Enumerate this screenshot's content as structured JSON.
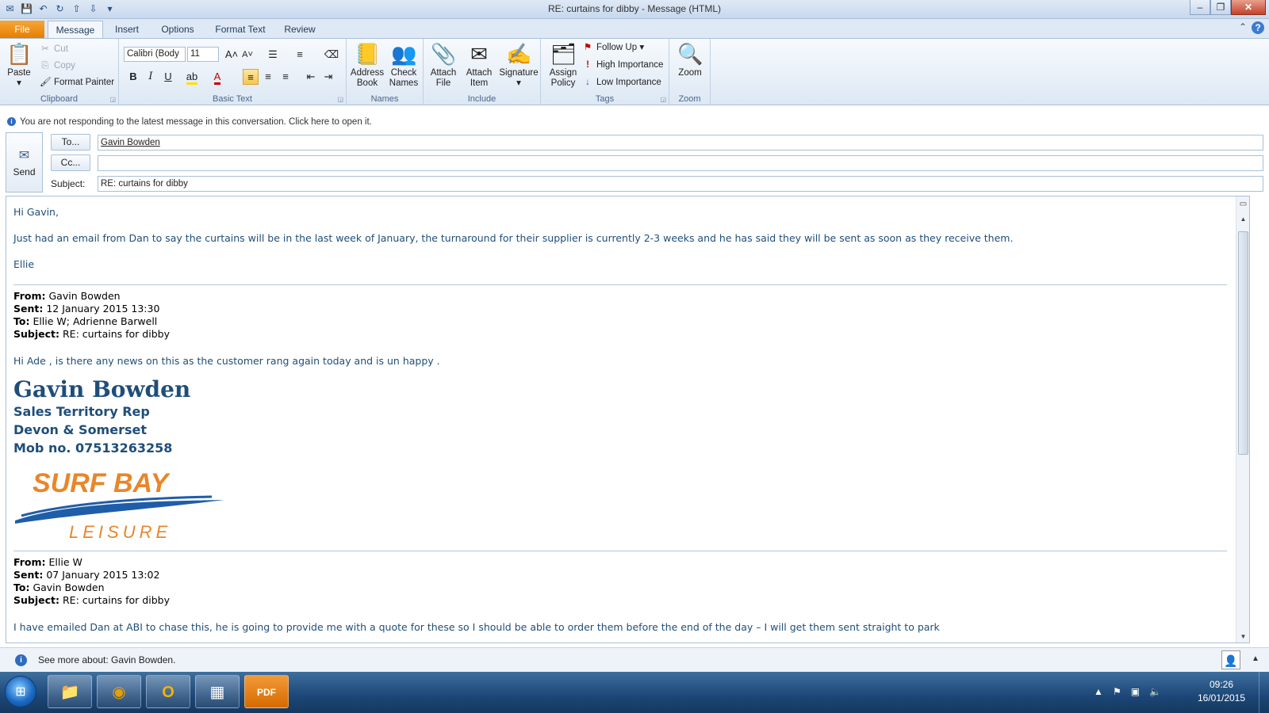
{
  "window": {
    "title": "RE: curtains for dibby  -  Message (HTML)",
    "controls": {
      "minimize": "–",
      "maximize": "❐",
      "close": "✕"
    }
  },
  "quick_access": [
    {
      "name": "outlook-app-icon",
      "glyph": "✉"
    },
    {
      "name": "save-icon",
      "glyph": "💾"
    },
    {
      "name": "undo-icon",
      "glyph": "↶"
    },
    {
      "name": "redo-icon",
      "glyph": "↻"
    },
    {
      "name": "up-icon",
      "glyph": "⇧"
    },
    {
      "name": "down-icon",
      "glyph": "⇩"
    },
    {
      "name": "customize-icon",
      "glyph": "▾"
    }
  ],
  "ribbon_tabs": [
    "File",
    "Message",
    "Insert",
    "Options",
    "Format Text",
    "Review"
  ],
  "ribbon": {
    "clipboard": {
      "label": "Clipboard",
      "paste": "Paste",
      "cut": "Cut",
      "copy": "Copy",
      "format_painter": "Format Painter"
    },
    "basic_text": {
      "label": "Basic Text",
      "font": "Calibri (Body",
      "size": "11",
      "bold": "B",
      "italic": "I",
      "underline": "U"
    },
    "names": {
      "label": "Names",
      "address_book": "Address Book",
      "check_names": "Check Names"
    },
    "include": {
      "label": "Include",
      "attach_file": "Attach File",
      "attach_item": "Attach Item",
      "signature": "Signature"
    },
    "tags": {
      "label": "Tags",
      "assign_policy": "Assign Policy",
      "follow_up": "Follow Up",
      "high_importance": "High Importance",
      "low_importance": "Low Importance"
    },
    "zoom": {
      "label": "Zoom",
      "zoom": "Zoom"
    }
  },
  "info_bar": "You are not responding to the latest message in this conversation. Click here to open it.",
  "compose": {
    "send": "Send",
    "to_button": "To...",
    "cc_button": "Cc...",
    "subject_label": "Subject:",
    "to_value": "Gavin Bowden",
    "cc_value": "",
    "subject_value": "RE: curtains for dibby"
  },
  "message": {
    "greeting": "Hi Gavin,",
    "paragraph": "Just had an email from Dan to say the curtains will be in the last week of January, the turnaround for their supplier is currently 2-3 weeks and he has said they will be sent as soon as they receive them.",
    "sign_off": "Ellie",
    "quoted1": {
      "from_label": "From:",
      "from": "Gavin Bowden",
      "sent_label": "Sent:",
      "sent": "12 January 2015 13:30",
      "to_label": "To:",
      "to": "Ellie W; Adrienne Barwell",
      "subject_label": "Subject:",
      "subject": "RE: curtains for dibby",
      "body": "Hi Ade , is there any news on this as the customer rang again today and is un happy ."
    },
    "signature": {
      "name": "Gavin Bowden",
      "title": "Sales Territory Rep",
      "region": "Devon & Somerset",
      "mobile": "Mob no. 07513263258",
      "logo_top": "SURF BAY",
      "logo_bottom": "LEISURE",
      "logo_color": "#e8862a",
      "wave_color": "#1f5da8"
    },
    "quoted2": {
      "from_label": "From:",
      "from": "Ellie W",
      "sent_label": "Sent:",
      "sent": "07 January 2015 13:02",
      "to_label": "To:",
      "to": "Gavin Bowden",
      "subject_label": "Subject:",
      "subject": "RE: curtains for dibby",
      "body_partial": "I have emailed Dan at ABI to chase this, he is going to provide me with a quote for these so I should be able to order them before the end of the day – I will get them sent straight to park"
    }
  },
  "people_pane": {
    "text": "See more about: Gavin Bowden."
  },
  "taskbar": {
    "apps": [
      {
        "name": "explorer-taskbar-icon",
        "glyph": "📁"
      },
      {
        "name": "chrome-taskbar-icon",
        "glyph": "◉"
      },
      {
        "name": "outlook-taskbar-icon",
        "glyph": "O"
      },
      {
        "name": "calculator-taskbar-icon",
        "glyph": "▦"
      },
      {
        "name": "pdf-taskbar-icon",
        "glyph": "PDF"
      }
    ],
    "time": "09:26",
    "date": "16/01/2015"
  },
  "colors": {
    "accent": "#e67e00",
    "body_text": "#1f4e79",
    "ribbon": "#dde8f4"
  }
}
